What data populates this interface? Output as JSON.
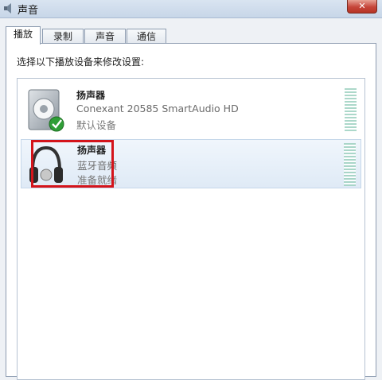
{
  "window": {
    "title": "声音",
    "close_symbol": "✕",
    "app_icon": "speaker-icon"
  },
  "tabs": [
    {
      "label": "播放",
      "active": true
    },
    {
      "label": "录制",
      "active": false
    },
    {
      "label": "声音",
      "active": false
    },
    {
      "label": "通信",
      "active": false
    }
  ],
  "instruction": "选择以下播放设备来修改设置:",
  "devices": [
    {
      "name": "扬声器",
      "description": "Conexant 20585 SmartAudio HD",
      "status": "默认设备",
      "icon": "speaker-icon",
      "badge": "checkmark-icon",
      "selected": false
    },
    {
      "name": "扬声器",
      "description": "蓝牙音频",
      "status": "准备就绪",
      "icon": "headphones-icon",
      "selected": true
    }
  ],
  "colors": {
    "accent_highlight": "#d4141b",
    "default_badge": "#2f9e36",
    "meter": "#9ed1c0"
  }
}
